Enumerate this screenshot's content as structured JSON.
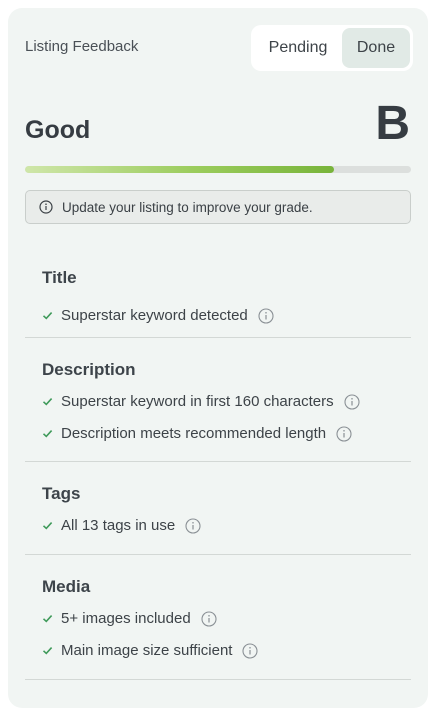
{
  "header": {
    "title": "Listing Feedback",
    "tabs": [
      {
        "label": "Pending",
        "active": false
      },
      {
        "label": "Done",
        "active": true
      }
    ]
  },
  "grade": {
    "label": "Good",
    "letter": "B",
    "progress_fraction": 0.8
  },
  "notice": {
    "text": "Update your listing to improve your grade."
  },
  "sections": [
    {
      "title": "Title",
      "items": [
        "Superstar keyword detected"
      ]
    },
    {
      "title": "Description",
      "items": [
        "Superstar keyword in first 160 characters",
        "Description meets recommended length"
      ]
    },
    {
      "title": "Tags",
      "items": [
        "All 13 tags in use"
      ]
    },
    {
      "title": "Media",
      "items": [
        "5+ images included",
        "Main image size sufficient"
      ]
    }
  ],
  "colors": {
    "panel_bg": "#f1f5f3",
    "check": "#3f9a5a",
    "progress_end": "#78b43a"
  }
}
